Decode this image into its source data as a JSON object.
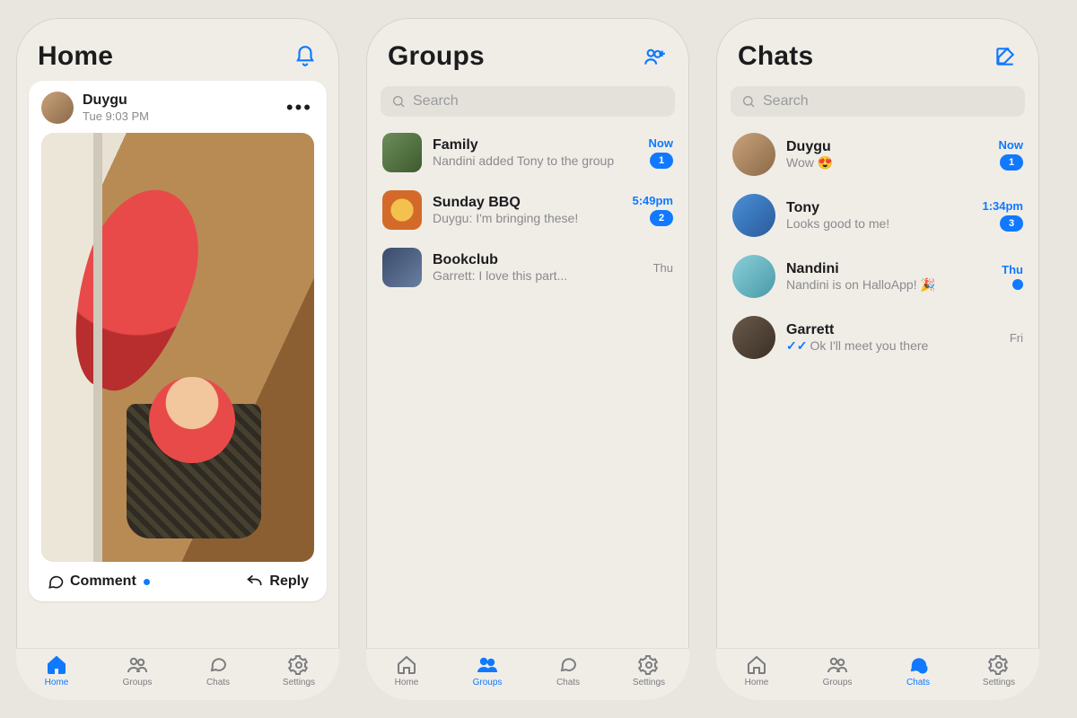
{
  "tabs": {
    "home": "Home",
    "groups": "Groups",
    "chats": "Chats",
    "settings": "Settings"
  },
  "home": {
    "title": "Home",
    "post": {
      "author": "Duygu",
      "time": "Tue 9:03 PM",
      "comment_label": "Comment",
      "reply_label": "Reply"
    }
  },
  "groups": {
    "title": "Groups",
    "search_placeholder": "Search",
    "items": [
      {
        "name": "Family",
        "sub": "Nandini added Tony to the group",
        "time": "Now",
        "badge": "1",
        "time_blue": true
      },
      {
        "name": "Sunday BBQ",
        "sub": "Duygu: I'm bringing these!",
        "time": "5:49pm",
        "badge": "2",
        "time_blue": true
      },
      {
        "name": "Bookclub",
        "sub": "Garrett: I love this part...",
        "time": "Thu",
        "badge": "",
        "time_blue": false
      }
    ]
  },
  "chats": {
    "title": "Chats",
    "search_placeholder": "Search",
    "items": [
      {
        "name": "Duygu",
        "sub": "Wow 😍",
        "time": "Now",
        "badge": "1",
        "time_blue": true,
        "dot": false,
        "read": false
      },
      {
        "name": "Tony",
        "sub": "Looks good to me!",
        "time": "1:34pm",
        "badge": "3",
        "time_blue": true,
        "dot": false,
        "read": false
      },
      {
        "name": "Nandini",
        "sub": "Nandini is on HalloApp! 🎉",
        "time": "Thu",
        "badge": "",
        "time_blue": true,
        "dot": true,
        "read": false
      },
      {
        "name": "Garrett",
        "sub": "Ok I'll meet you there",
        "time": "Fri",
        "badge": "",
        "time_blue": false,
        "dot": false,
        "read": true
      }
    ]
  }
}
